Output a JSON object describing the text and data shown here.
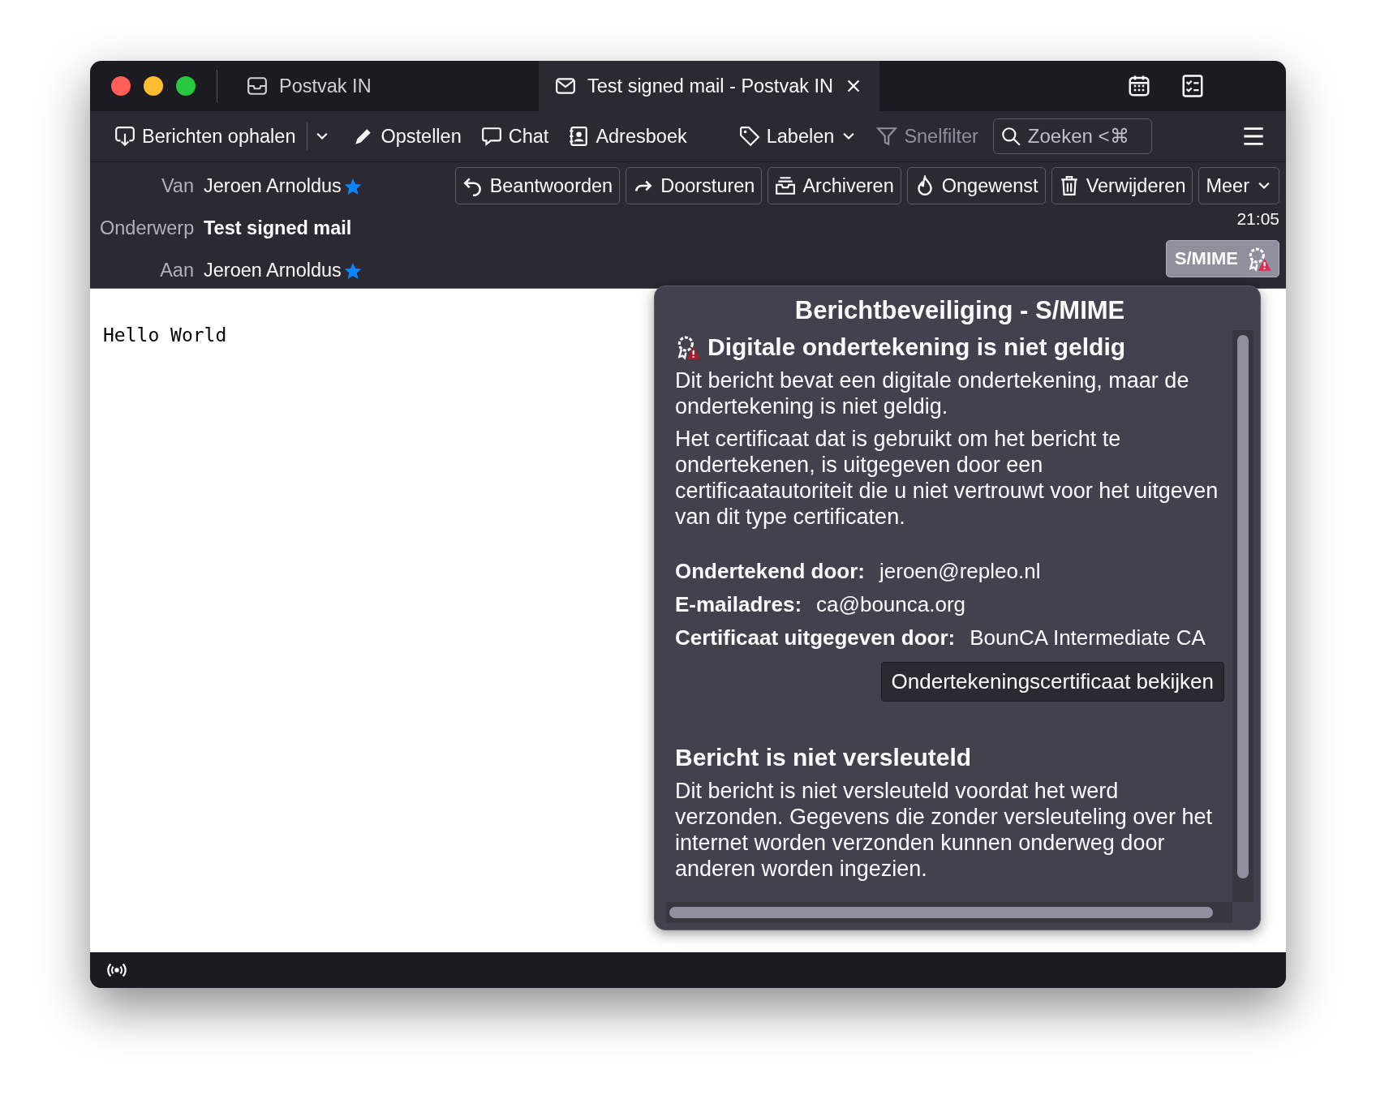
{
  "tabs": [
    {
      "label": "Postvak IN",
      "kind": "inbox",
      "selected": false,
      "closable": false
    },
    {
      "label": "Test signed mail - Postvak IN",
      "kind": "mail",
      "selected": true,
      "closable": true
    }
  ],
  "toolbar": {
    "items": [
      {
        "label": "Berichten ophalen",
        "kind": "download",
        "menu_button": true,
        "disabled": false
      },
      {
        "label": "Opstellen",
        "kind": "pencil",
        "disabled": false
      },
      {
        "label": "Chat",
        "kind": "chat",
        "disabled": false
      },
      {
        "label": "Adresboek",
        "kind": "contacts",
        "disabled": false
      },
      {
        "label": "Labelen",
        "kind": "tag",
        "dropdown": true,
        "disabled": false
      },
      {
        "label": "Snelfilter",
        "kind": "filter",
        "disabled": true
      }
    ],
    "search": {
      "placeholder": "Zoeken <⌘"
    }
  },
  "header": {
    "fields": [
      {
        "label": "Van",
        "value": "Jeroen Arnoldus",
        "starred": true,
        "bold": false
      },
      {
        "label": "Onderwerp",
        "value": "Test signed mail",
        "starred": false,
        "bold": true
      },
      {
        "label": "Aan",
        "value": "Jeroen Arnoldus",
        "starred": true,
        "bold": false
      }
    ],
    "actions": [
      {
        "label": "Beantwoorden",
        "kind": "reply"
      },
      {
        "label": "Doorsturen",
        "kind": "forward"
      },
      {
        "label": "Archiveren",
        "kind": "archive"
      },
      {
        "label": "Ongewenst",
        "kind": "flame"
      },
      {
        "label": "Verwijderen",
        "kind": "trash"
      },
      {
        "label": "Meer",
        "kind": "more"
      }
    ],
    "time": "21:05",
    "security_button": "S/MIME"
  },
  "body": {
    "text": "Hello World"
  },
  "popup": {
    "title": "Berichtbeveiliging - S/MIME",
    "signature": {
      "heading": "Digitale ondertekening is niet geldig",
      "paragraphs": [
        "Dit bericht bevat een digitale ondertekening, maar de ondertekening is niet geldig.",
        "Het certificaat dat is gebruikt om het bericht te ondertekenen, is uitgegeven door een certificaatautoriteit die u niet vertrouwt voor het uitgeven van dit type certificaten."
      ],
      "details": [
        {
          "label": "Ondertekend door:",
          "value": "jeroen@repleo.nl"
        },
        {
          "label": "E-mailadres:",
          "value": "ca@bounca.org"
        },
        {
          "label": "Certificaat uitgegeven door:",
          "value": "BounCA Intermediate CA"
        }
      ],
      "button": "Ondertekeningscertificaat bekijken"
    },
    "encryption": {
      "heading": "Bericht is niet versleuteld",
      "paragraph": "Dit bericht is niet versleuteld voordat het werd verzonden. Gegevens die zonder versleuteling over het internet worden verzonden kunnen onderweg door anderen worden ingezien."
    }
  }
}
